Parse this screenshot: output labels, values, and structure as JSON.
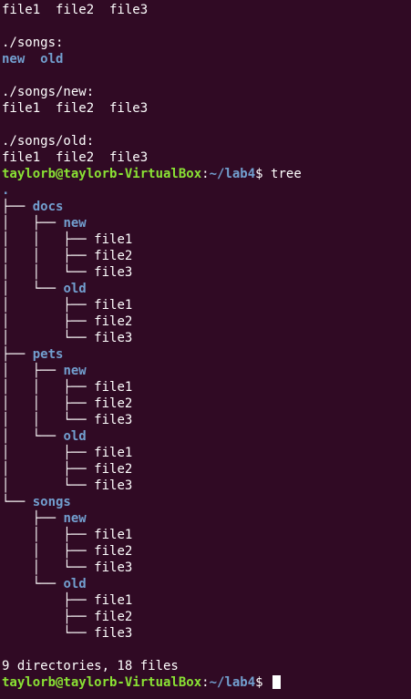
{
  "terminal": {
    "prompt": {
      "user_host": "taylorb@taylorb-VirtualBox",
      "sep": ":",
      "cwd": "~/lab4",
      "symbol": "$ "
    },
    "ls": {
      "top_files": "file1  file2  file3",
      "songs_header": "./songs:",
      "songs_new": "new",
      "songs_old": "old",
      "songs_new_header": "./songs/new:",
      "songs_new_files": "file1  file2  file3",
      "songs_old_header": "./songs/old:",
      "songs_old_files": "file1  file2  file3"
    },
    "command": "tree",
    "tree": {
      "root": ".",
      "docs": "docs",
      "pets": "pets",
      "songs": "songs",
      "new": "new",
      "old": "old",
      "file1": "file1",
      "file2": "file2",
      "file3": "file3",
      "g_top_child": "├── ",
      "g_top_last": "└── ",
      "g_bar_child": "│   ├── ",
      "g_bar_last": "│   └── ",
      "g_sp_child": "    ├── ",
      "g_sp_last": "    └── ",
      "g_bb_child": "│   │   ├── ",
      "g_bb_last": "│   │   └── ",
      "g_bs_child": "│       ├── ",
      "g_bs_last": "│       └── ",
      "g_sb_child": "    │   ├── ",
      "g_sb_last": "    │   └── ",
      "g_ss_child": "        ├── ",
      "g_ss_last": "        └── "
    },
    "summary": "9 directories, 18 files"
  }
}
